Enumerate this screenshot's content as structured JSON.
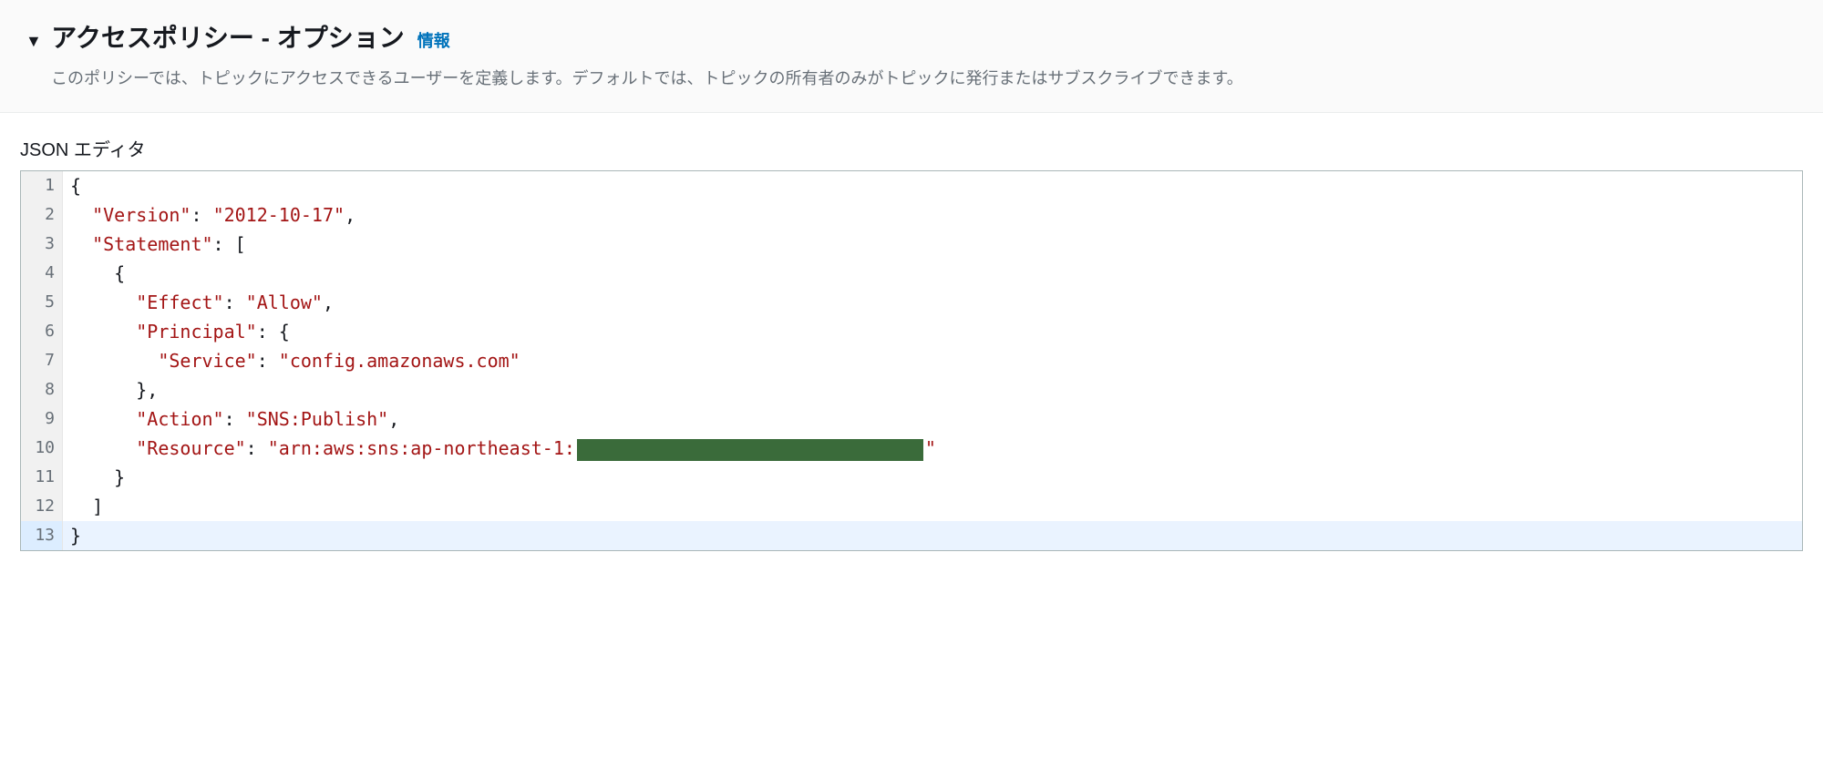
{
  "header": {
    "collapse_icon": "▼",
    "title": "アクセスポリシー - オプション",
    "info_label": "情報",
    "description": "このポリシーでは、トピックにアクセスできるユーザーを定義します。デフォルトでは、トピックの所有者のみがトピックに発行またはサブスクライブできます。"
  },
  "editor": {
    "label": "JSON エディタ",
    "policy": {
      "Version": "2012-10-17",
      "Statement": [
        {
          "Effect": "Allow",
          "Principal": {
            "Service": "config.amazonaws.com"
          },
          "Action": "SNS:Publish",
          "Resource": "arn:aws:sns:ap-northeast-1:[REDACTED]"
        }
      ]
    },
    "lines": {
      "l1": "{",
      "l2_key": "\"Version\"",
      "l2_val": "\"2012-10-17\"",
      "l3_key": "\"Statement\"",
      "l4": "{",
      "l5_key": "\"Effect\"",
      "l5_val": "\"Allow\"",
      "l6_key": "\"Principal\"",
      "l7_key": "\"Service\"",
      "l7_val": "\"config.amazonaws.com\"",
      "l8": "},",
      "l9_key": "\"Action\"",
      "l9_val": "\"SNS:Publish\"",
      "l10_key": "\"Resource\"",
      "l10_val_prefix": "\"arn:aws:sns:ap-northeast-1:",
      "l10_val_suffix": "\"",
      "l11": "}",
      "l12": "]",
      "l13": "}"
    },
    "line_numbers": [
      "1",
      "2",
      "3",
      "4",
      "5",
      "6",
      "7",
      "8",
      "9",
      "10",
      "11",
      "12",
      "13"
    ]
  }
}
